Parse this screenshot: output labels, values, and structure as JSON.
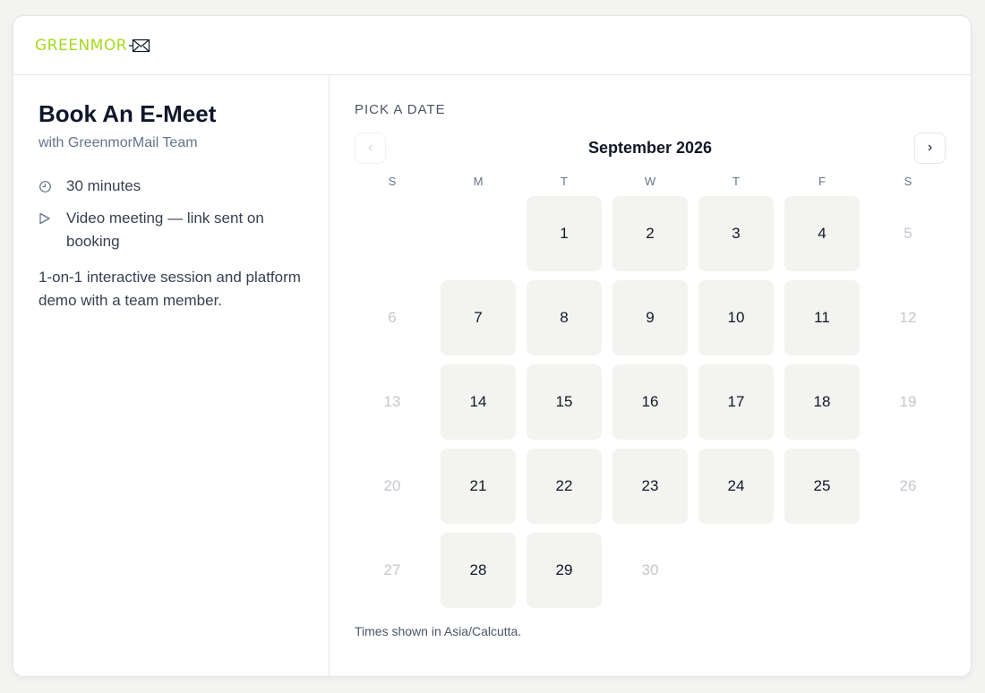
{
  "brand": {
    "name": "GREENMOR",
    "accent": "#a6d91f"
  },
  "event": {
    "title": "Book An E-Meet",
    "host": "with GreenmorMail Team",
    "duration": "30 minutes",
    "location": "Video meeting — link sent on booking",
    "description": "1-on-1 interactive session and platform demo with a team member.",
    "icons": {
      "duration": "clock-icon",
      "location": "play-icon"
    }
  },
  "calendar": {
    "section_label": "PICK A DATE",
    "month_label": "September 2026",
    "prev_label": "‹",
    "next_label": "›",
    "weekdays": [
      "S",
      "M",
      "T",
      "W",
      "T",
      "F",
      "S"
    ],
    "leading_blanks": 2,
    "days": [
      {
        "d": "1",
        "available": true
      },
      {
        "d": "2",
        "available": true
      },
      {
        "d": "3",
        "available": true
      },
      {
        "d": "4",
        "available": true
      },
      {
        "d": "5",
        "available": false
      },
      {
        "d": "6",
        "available": false
      },
      {
        "d": "7",
        "available": true
      },
      {
        "d": "8",
        "available": true
      },
      {
        "d": "9",
        "available": true
      },
      {
        "d": "10",
        "available": true
      },
      {
        "d": "11",
        "available": true
      },
      {
        "d": "12",
        "available": false
      },
      {
        "d": "13",
        "available": false
      },
      {
        "d": "14",
        "available": true
      },
      {
        "d": "15",
        "available": true
      },
      {
        "d": "16",
        "available": true
      },
      {
        "d": "17",
        "available": true
      },
      {
        "d": "18",
        "available": true
      },
      {
        "d": "19",
        "available": false
      },
      {
        "d": "20",
        "available": false
      },
      {
        "d": "21",
        "available": true
      },
      {
        "d": "22",
        "available": true
      },
      {
        "d": "23",
        "available": true
      },
      {
        "d": "24",
        "available": true
      },
      {
        "d": "25",
        "available": true
      },
      {
        "d": "26",
        "available": false
      },
      {
        "d": "27",
        "available": false
      },
      {
        "d": "28",
        "available": true
      },
      {
        "d": "29",
        "available": true
      },
      {
        "d": "30",
        "available": false
      }
    ],
    "timezone_note": "Times shown in Asia/Calcutta."
  }
}
